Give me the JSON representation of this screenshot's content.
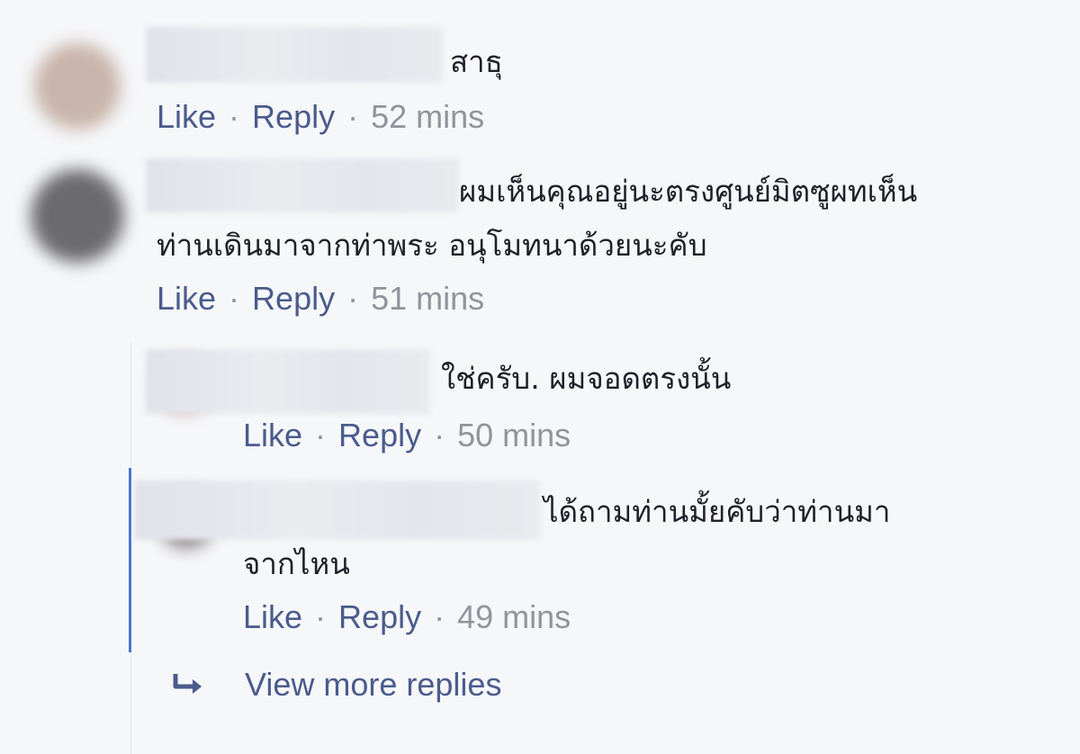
{
  "colors": {
    "link": "#4b5b8c",
    "meta": "#90949c",
    "text": "#1d2129",
    "thread_line": "#4a76d4",
    "background": "#f6f7f9"
  },
  "separator": "·",
  "comments": [
    {
      "text_lines": [
        "สาธุ"
      ],
      "like": "Like",
      "reply": "Reply",
      "time": "52 mins"
    },
    {
      "text_lines": [
        "ผมเห็นคุณอยู่นะตรงศูนย์มิตซูผทเห็น",
        "ท่านเดินมาจากท่าพระ อนุโมทนาด้วยนะคับ"
      ],
      "like": "Like",
      "reply": "Reply",
      "time": "51 mins"
    },
    {
      "text_lines": [
        "ใช่ครับ. ผมจอดตรงนั้น"
      ],
      "like": "Like",
      "reply": "Reply",
      "time": "50 mins"
    },
    {
      "text_lines": [
        "ได้ถามท่านมั้ยคับว่าท่านมา",
        "จากไหน"
      ],
      "like": "Like",
      "reply": "Reply",
      "time": "49 mins"
    }
  ],
  "view_more": {
    "label": "View more replies",
    "icon": "reply-arrow-icon"
  }
}
